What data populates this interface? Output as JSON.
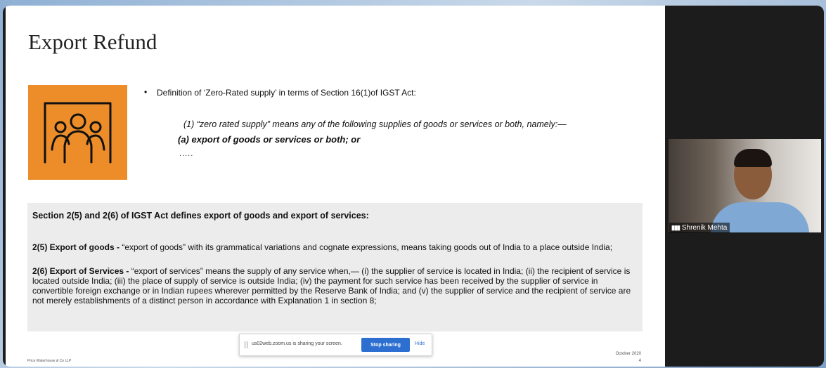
{
  "slide": {
    "title": "Export Refund",
    "bullet": "Definition of ‘Zero-Rated supply’ in terms of Section 16(1)of IGST Act:",
    "quote_line1": "(1) “zero rated supply” means any of the following supplies of goods or services or both, namely:—",
    "quote_line2": "(a) export of goods or services or both; or",
    "ellipsis": ".....",
    "box_heading": "Section 2(5) and 2(6) of IGST Act defines export of goods and export of services:",
    "p1_bold": "2(5) Export of goods -",
    "p1_text": " “export of goods” with its grammatical variations and cognate expressions, means taking goods out of India to a place outside India;",
    "p2_bold": "2(6) Export of Services -",
    "p2_text": " “export of services” means the supply of any service when,— (i) the supplier of service is located in India; (ii) the recipient of service is located outside India; (iii) the place of supply of service is outside India; (iv) the payment for such service has been received by the supplier of service in convertible foreign exchange or in Indian rupees wherever permitted by the Reserve Bank of India; and (v) the supplier of service and the recipient of service are not merely establishments of a distinct person in accordance with Explanation 1 in section 8;",
    "footer_left": "Price Waterhouse & Co LLP",
    "footer_date": "October 2020",
    "footer_page": "4",
    "icon": "people-group-icon",
    "accent_color": "#ec8d2a"
  },
  "share_bar": {
    "message": "us02web.zoom.us is sharing your screen.",
    "stop_label": "Stop sharing",
    "hide_label": "Hide"
  },
  "participant": {
    "name": "Shrenik Mehta",
    "signal_icon": "signal-bars-icon"
  }
}
